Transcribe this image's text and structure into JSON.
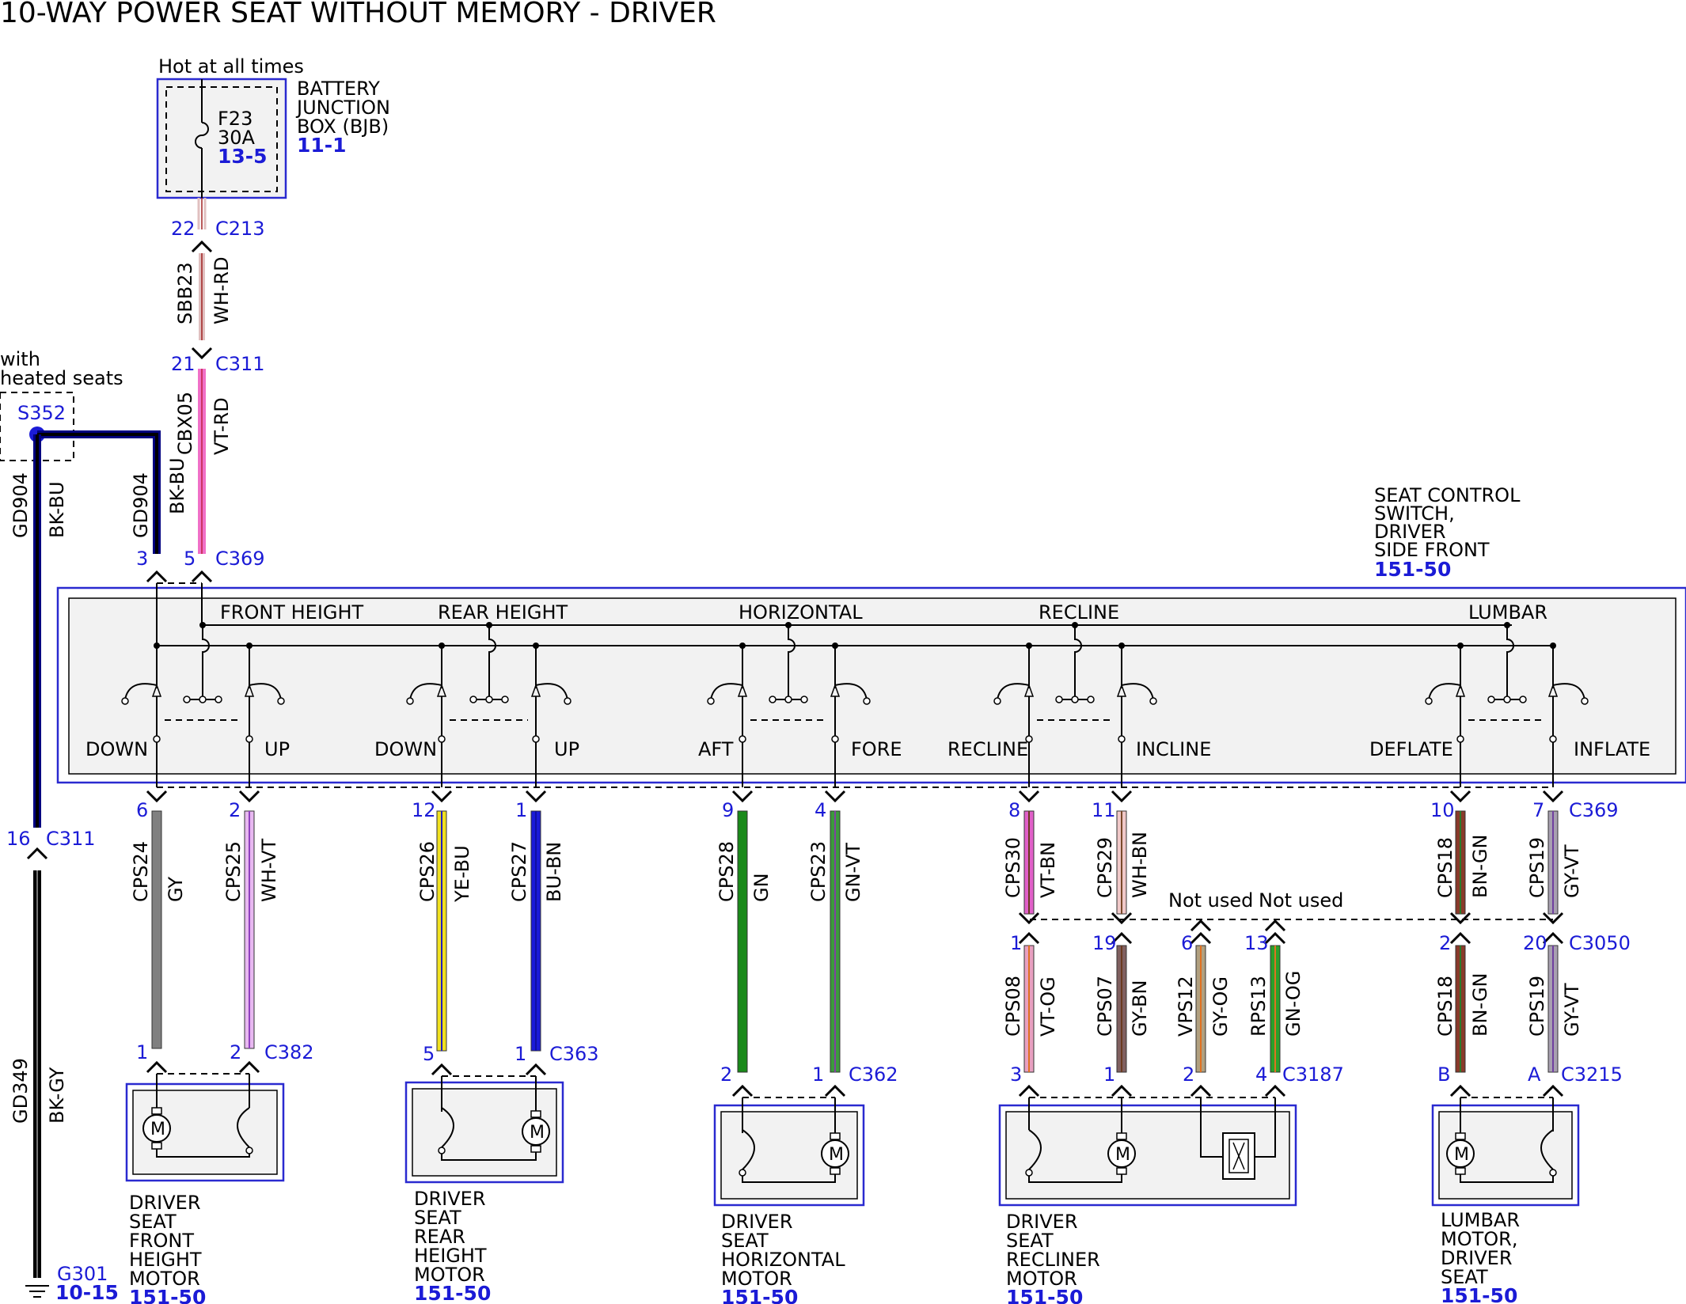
{
  "title": "10-WAY POWER SEAT WITHOUT MEMORY - DRIVER",
  "hot_label": "Hot at all times",
  "fuse": {
    "name": "F23",
    "rating": "30A",
    "ref": "13-5"
  },
  "bjb": {
    "l1": "BATTERY",
    "l2": "JUNCTION",
    "l3": "BOX (BJB)",
    "ref": "11-1"
  },
  "heated": {
    "l1": "with",
    "l2": "heated seats",
    "splice": "S352"
  },
  "scs": {
    "l1": "SEAT CONTROL",
    "l2": "SWITCH,",
    "l3": "DRIVER",
    "l4": "SIDE FRONT",
    "ref": "151-50"
  },
  "switch_groups": [
    {
      "name": "FRONT HEIGHT",
      "left": "DOWN",
      "right": "UP"
    },
    {
      "name": "REAR HEIGHT",
      "left": "DOWN",
      "right": "UP"
    },
    {
      "name": "HORIZONTAL",
      "left": "AFT",
      "right": "FORE"
    },
    {
      "name": "RECLINE",
      "left": "RECLINE",
      "right": "INCLINE"
    },
    {
      "name": "LUMBAR",
      "left": "DEFLATE",
      "right": "INFLATE"
    }
  ],
  "wires": {
    "sbb23": {
      "circuit": "SBB23",
      "color": "WH-RD"
    },
    "cbx05": {
      "circuit": "CBX05",
      "color": "VT-RD"
    },
    "gd904a": {
      "circuit": "GD904",
      "color": "BK-BU"
    },
    "gd904b": {
      "circuit": "GD904",
      "color": "BK-BU"
    },
    "gd349": {
      "circuit": "GD349",
      "color": "BK-GY"
    },
    "cps24": {
      "circuit": "CPS24",
      "color": "GY"
    },
    "cps25": {
      "circuit": "CPS25",
      "color": "WH-VT"
    },
    "cps26": {
      "circuit": "CPS26",
      "color": "YE-BU"
    },
    "cps27": {
      "circuit": "CPS27",
      "color": "BU-BN"
    },
    "cps28": {
      "circuit": "CPS28",
      "color": "GN"
    },
    "cps23": {
      "circuit": "CPS23",
      "color": "GN-VT"
    },
    "cps30": {
      "circuit": "CPS30",
      "color": "VT-BN"
    },
    "cps29": {
      "circuit": "CPS29",
      "color": "WH-BN"
    },
    "cps18a": {
      "circuit": "CPS18",
      "color": "BN-GN"
    },
    "cps19a": {
      "circuit": "CPS19",
      "color": "GY-VT"
    },
    "cps08": {
      "circuit": "CPS08",
      "color": "VT-OG"
    },
    "cps07": {
      "circuit": "CPS07",
      "color": "GY-BN"
    },
    "vps12": {
      "circuit": "VPS12",
      "color": "GY-OG"
    },
    "rps13": {
      "circuit": "RPS13",
      "color": "GN-OG"
    },
    "cps18b": {
      "circuit": "CPS18",
      "color": "BN-GN"
    },
    "cps19b": {
      "circuit": "CPS19",
      "color": "GY-VT"
    }
  },
  "connectors": {
    "c213": {
      "pin": "22",
      "name": "C213"
    },
    "c311a": {
      "pin": "21",
      "name": "C311"
    },
    "c311b": {
      "pin": "16",
      "name": "C311"
    },
    "c369": {
      "name": "C369",
      "pins": {
        "p3": "3",
        "p5": "5",
        "p6": "6",
        "p2": "2",
        "p12": "12",
        "p1": "1",
        "p9": "9",
        "p4": "4",
        "p8": "8",
        "p11": "11",
        "p10": "10",
        "p7": "7"
      }
    },
    "c382": {
      "name": "C382",
      "pin1": "1",
      "pin2": "2"
    },
    "c363": {
      "name": "C363",
      "pin1": "5",
      "pin2": "1"
    },
    "c362": {
      "name": "C362",
      "pin1": "2",
      "pin2": "1"
    },
    "c3050": {
      "name": "C3050",
      "pins": {
        "p1": "1",
        "p19": "19",
        "p6": "6",
        "p13": "13",
        "p2": "2",
        "p20": "20"
      }
    },
    "c3187": {
      "name": "C3187",
      "pins": {
        "p3": "3",
        "p1": "1",
        "p2": "2",
        "p4": "4"
      }
    },
    "c3215": {
      "name": "C3215",
      "pinB": "B",
      "pinA": "A"
    }
  },
  "not_used": "Not used",
  "motor_symbol": "M",
  "ground": {
    "name": "G301",
    "ref": "10-15"
  },
  "components": {
    "front": {
      "l1": "DRIVER",
      "l2": "SEAT",
      "l3": "FRONT",
      "l4": "HEIGHT",
      "l5": "MOTOR",
      "ref": "151-50"
    },
    "rear": {
      "l1": "DRIVER",
      "l2": "SEAT",
      "l3": "REAR",
      "l4": "HEIGHT",
      "l5": "MOTOR",
      "ref": "151-50"
    },
    "horiz": {
      "l1": "DRIVER",
      "l2": "SEAT",
      "l3": "HORIZONTAL",
      "l4": "MOTOR",
      "ref": "151-50"
    },
    "recline": {
      "l1": "DRIVER",
      "l2": "SEAT",
      "l3": "RECLINER",
      "l4": "MOTOR",
      "ref": "151-50"
    },
    "lumbar": {
      "l1": "LUMBAR",
      "l2": "MOTOR,",
      "l3": "DRIVER",
      "l4": "SEAT",
      "ref": "151-50"
    }
  },
  "colors": {
    "wire_text_blue": "#1b1bd6",
    "box_blue": "#2a2ad0",
    "panel_fill": "#f2f2f2",
    "gy": "#808080",
    "wh_vt": "#e8b8f0",
    "ye_bu": "#f0e020",
    "bu_bn": "#1a1ad8",
    "gn": "#1a8a1a",
    "gn_vt": "#3c9a3c",
    "vt_bn": "#e060c8",
    "wh_bn": "#f0c8c8",
    "bn_gn": "#8a3a2a",
    "gy_vt": "#a8a0b0",
    "vt_og": "#e8a0c0",
    "gy_bn": "#806060",
    "gy_og": "#b0a080",
    "gn_og": "#2aa02a",
    "vt_rd": "#f070c8",
    "wh_rd": "#e0c0c0",
    "bk_bu": "#000080",
    "bk_gy": "#000000"
  }
}
